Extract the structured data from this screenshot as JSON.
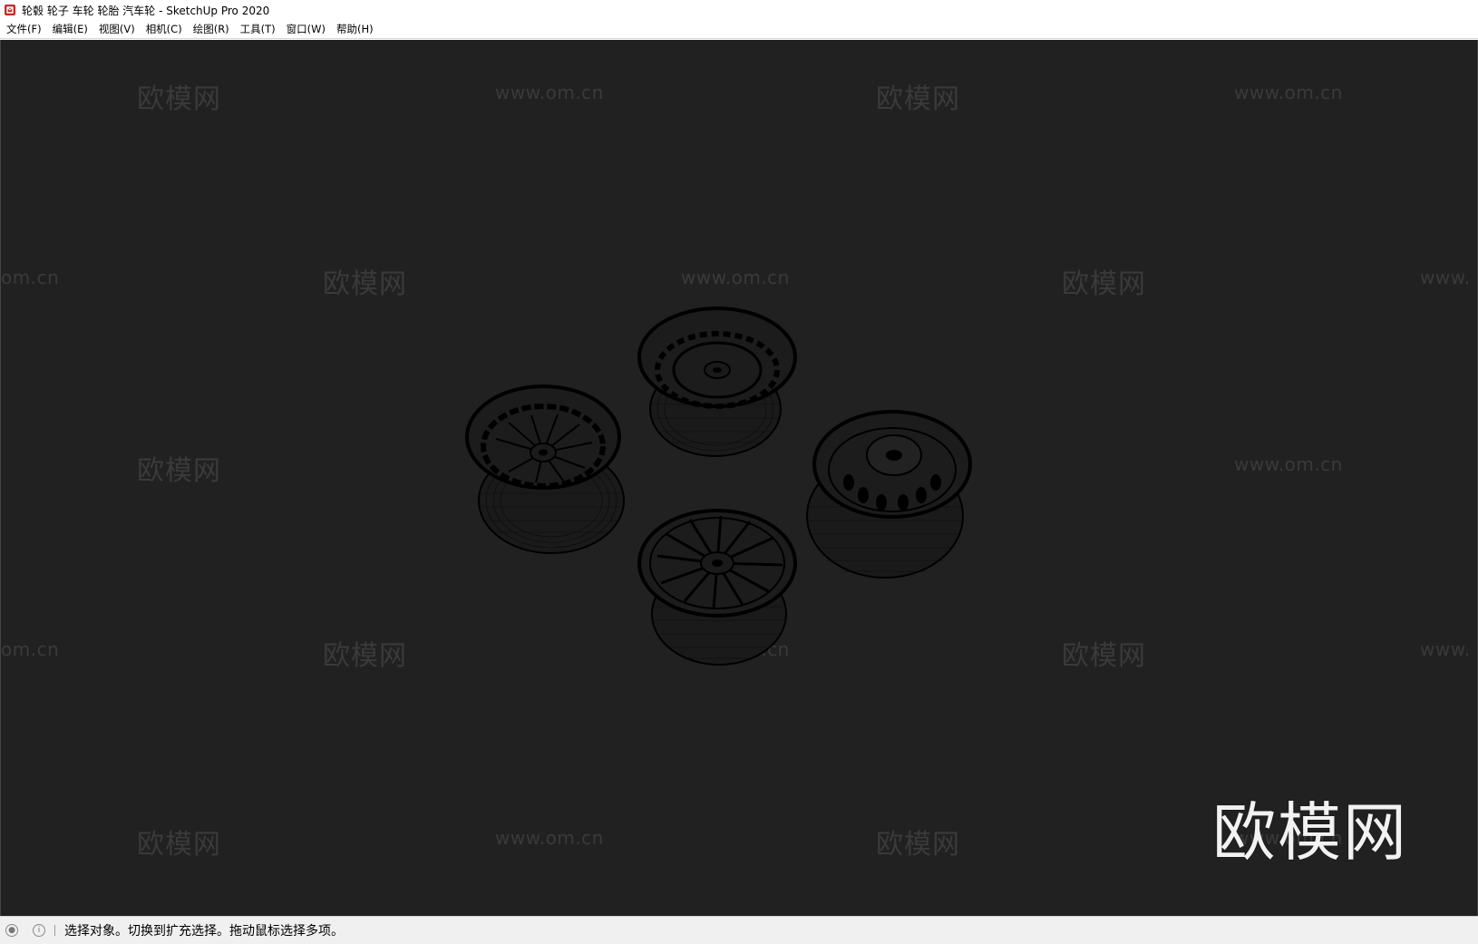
{
  "window": {
    "title": "轮毂 轮子 车轮 轮胎 汽车轮 - SketchUp Pro 2020"
  },
  "menu": {
    "items": [
      {
        "label": "文件(F)"
      },
      {
        "label": "编辑(E)"
      },
      {
        "label": "视图(V)"
      },
      {
        "label": "相机(C)"
      },
      {
        "label": "绘图(R)"
      },
      {
        "label": "工具(T)"
      },
      {
        "label": "窗口(W)"
      },
      {
        "label": "帮助(H)"
      }
    ]
  },
  "viewport": {
    "background": "#212121",
    "watermark_cn": "欧模网",
    "watermark_url": "www.om.cn",
    "watermark_url_partial_left": "om.cn",
    "watermark_url_partial_right": "www.",
    "logo_text": "欧模网"
  },
  "statusbar": {
    "icons": [
      "geo-location-icon",
      "info-icon"
    ],
    "message": "选择对象。切换到扩充选择。拖动鼠标选择多项。"
  },
  "colors": {
    "app_icon": "#c62828",
    "wireframe": "#000000",
    "watermark": "#3a3a3a",
    "logo": "#f2f2f2"
  }
}
